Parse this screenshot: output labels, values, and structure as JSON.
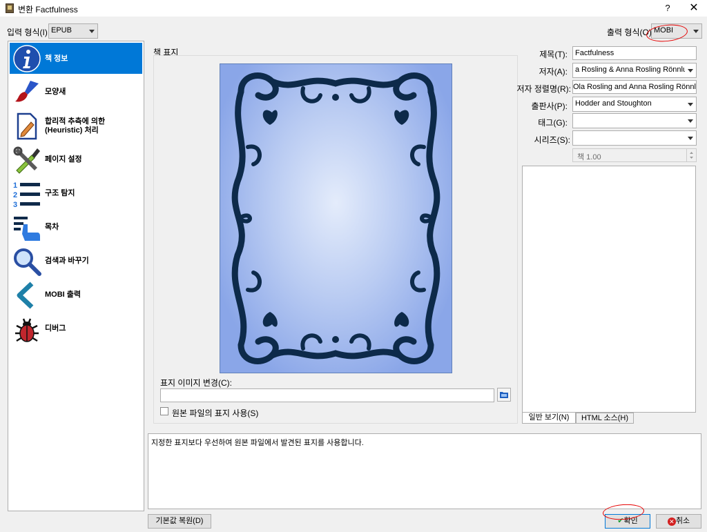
{
  "window": {
    "title": "변환 Factfulness",
    "help_label": "?",
    "close_label": "✕"
  },
  "input_format": {
    "label": "입력 형식(I):",
    "value": "EPUB"
  },
  "output_format": {
    "label": "출력 형식(O):",
    "value": "MOBI"
  },
  "sidebar": {
    "items": [
      {
        "label": "책 정보",
        "icon": "info-icon"
      },
      {
        "label": "모양새",
        "icon": "paintbrush-icon"
      },
      {
        "label": "합리적 추측에 의한\n(Heuristic) 처리",
        "icon": "document-edit-icon"
      },
      {
        "label": "페이지 설정",
        "icon": "tools-icon"
      },
      {
        "label": "구조 탐지",
        "icon": "numbered-list-icon"
      },
      {
        "label": "목차",
        "icon": "toc-icon"
      },
      {
        "label": "검색과 바꾸기",
        "icon": "magnifier-icon"
      },
      {
        "label": "MOBI 출력",
        "icon": "chevron-left-icon"
      },
      {
        "label": "디버그",
        "icon": "bug-icon"
      }
    ]
  },
  "cover": {
    "group_label": "책 표지",
    "change_label": "표지 이미지 변경(C):",
    "path_value": "",
    "use_source_label": "원본 파일의 표지 사용(S)"
  },
  "metadata": {
    "title_label": "제목(T):",
    "title_value": "Factfulness",
    "author_label": "저자(A):",
    "author_value": "a Rosling & Anna Rosling Rönnlund",
    "author_sort_label": "저자 정렬명(R):",
    "author_sort_value": "Ola Rosling and Anna Rosling Rönnlund",
    "publisher_label": "출판사(P):",
    "publisher_value": "Hodder and Stoughton",
    "tags_label": "태그(G):",
    "tags_value": "",
    "series_label": "시리즈(S):",
    "series_value": "",
    "series_index": "책 1.00"
  },
  "comments": {
    "tab_normal": "일반 보기(N)",
    "tab_html": "HTML 소스(H)"
  },
  "help_text": "지정한 표지보다 우선하여 원본 파일에서 발견된 표지를 사용합니다.",
  "buttons": {
    "restore_defaults": "기본값 복원(D)",
    "ok": "확인",
    "cancel": "취소"
  },
  "colors": {
    "selection": "#0078d7",
    "annotation": "#e60000",
    "cover_ornament": "#0d2a4a"
  }
}
